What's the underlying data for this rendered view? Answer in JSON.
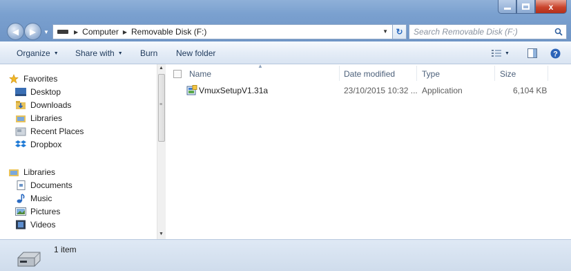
{
  "window": {
    "controls": {
      "minimize": "minimize",
      "maximize": "maximize",
      "close": "x"
    }
  },
  "address_bar": {
    "crumbs": [
      "Computer",
      "Removable Disk (F:)"
    ],
    "search_placeholder": "Search Removable Disk (F:)"
  },
  "toolbar": {
    "organize": "Organize",
    "share_with": "Share with",
    "burn": "Burn",
    "new_folder": "New folder"
  },
  "nav": {
    "favorites_header": "Favorites",
    "favorites": [
      "Desktop",
      "Downloads",
      "Libraries",
      "Recent Places",
      "Dropbox"
    ],
    "libraries_header": "Libraries",
    "libraries": [
      "Documents",
      "Music",
      "Pictures",
      "Videos"
    ]
  },
  "columns": {
    "name": "Name",
    "date_modified": "Date modified",
    "type": "Type",
    "size": "Size"
  },
  "files": [
    {
      "name": "VmuxSetupV1.31a",
      "date_modified": "23/10/2015 10:32 ...",
      "type": "Application",
      "size": "6,104 KB"
    }
  ],
  "status": {
    "item_count": "1 item"
  },
  "colors": {
    "title_gradient": "#7aa0cf",
    "toolbar_bg": "#e5edf7",
    "status_bg": "#d6e2f0"
  },
  "icons": {
    "favorites_header": "star-icon",
    "desktop": "desktop-icon",
    "downloads": "downloads-folder-icon",
    "libraries": "libraries-icon",
    "recent_places": "recent-places-icon",
    "dropbox": "dropbox-icon",
    "documents": "documents-icon",
    "music": "music-icon",
    "pictures": "pictures-icon",
    "videos": "videos-icon",
    "file": "installer-icon",
    "status": "removable-drive-icon"
  }
}
